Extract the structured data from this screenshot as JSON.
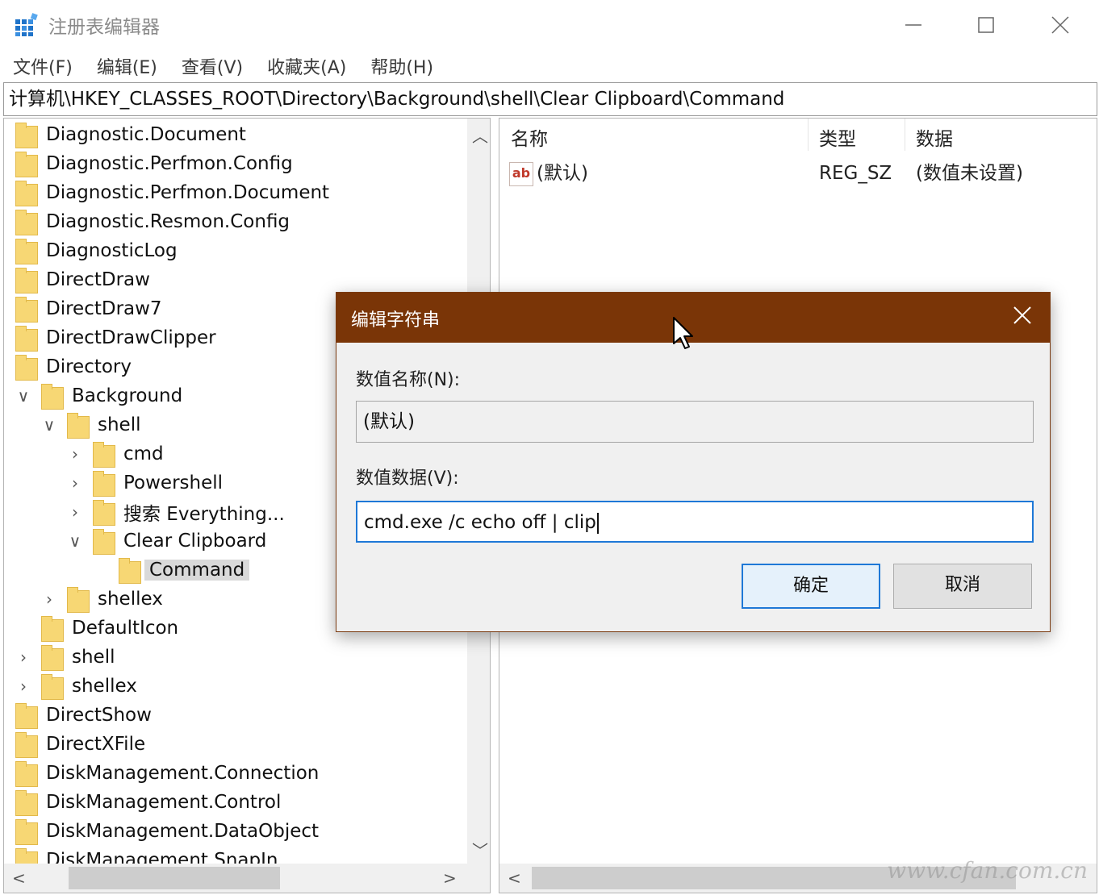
{
  "window": {
    "title": "注册表编辑器",
    "minimize_icon": "minimize-icon",
    "maximize_icon": "maximize-icon",
    "close_icon": "close-icon"
  },
  "menu": [
    "文件(F)",
    "编辑(E)",
    "查看(V)",
    "收藏夹(A)",
    "帮助(H)"
  ],
  "address": "计算机\\HKEY_CLASSES_ROOT\\Directory\\Background\\shell\\Clear Clipboard\\Command",
  "tree": [
    {
      "label": "Diagnostic.Document",
      "level": 0,
      "expander": ""
    },
    {
      "label": "Diagnostic.Perfmon.Config",
      "level": 0,
      "expander": ""
    },
    {
      "label": "Diagnostic.Perfmon.Document",
      "level": 0,
      "expander": ""
    },
    {
      "label": "Diagnostic.Resmon.Config",
      "level": 0,
      "expander": ""
    },
    {
      "label": "DiagnosticLog",
      "level": 0,
      "expander": ""
    },
    {
      "label": "DirectDraw",
      "level": 0,
      "expander": ""
    },
    {
      "label": "DirectDraw7",
      "level": 0,
      "expander": ""
    },
    {
      "label": "DirectDrawClipper",
      "level": 0,
      "expander": ""
    },
    {
      "label": "Directory",
      "level": 0,
      "expander": ""
    },
    {
      "label": "Background",
      "level": 1,
      "expander": "expanded"
    },
    {
      "label": "shell",
      "level": 2,
      "expander": "expanded"
    },
    {
      "label": "cmd",
      "level": 3,
      "expander": "collapsed"
    },
    {
      "label": "Powershell",
      "level": 3,
      "expander": "collapsed"
    },
    {
      "label": "搜索 Everything...",
      "level": 3,
      "expander": "collapsed"
    },
    {
      "label": "Clear Clipboard",
      "level": 3,
      "expander": "expanded"
    },
    {
      "label": "Command",
      "level": 4,
      "expander": "",
      "selected": true
    },
    {
      "label": "shellex",
      "level": 2,
      "expander": "collapsed"
    },
    {
      "label": "DefaultIcon",
      "level": 1,
      "expander": ""
    },
    {
      "label": "shell",
      "level": 1,
      "expander": "collapsed"
    },
    {
      "label": "shellex",
      "level": 1,
      "expander": "collapsed"
    },
    {
      "label": "DirectShow",
      "level": 0,
      "expander": ""
    },
    {
      "label": "DirectXFile",
      "level": 0,
      "expander": ""
    },
    {
      "label": "DiskManagement.Connection",
      "level": 0,
      "expander": ""
    },
    {
      "label": "DiskManagement.Control",
      "level": 0,
      "expander": ""
    },
    {
      "label": "DiskManagement.DataObject",
      "level": 0,
      "expander": ""
    },
    {
      "label": "DiskManagement.SnapIn",
      "level": 0,
      "expander": ""
    }
  ],
  "list": {
    "columns": [
      "名称",
      "类型",
      "数据"
    ],
    "rows": [
      {
        "icon": "string-value-icon",
        "icon_text": "ab",
        "name": "(默认)",
        "type": "REG_SZ",
        "data": "(数值未设置)"
      }
    ]
  },
  "dialog": {
    "title": "编辑字符串",
    "name_label": "数值名称(N):",
    "name_value": "(默认)",
    "data_label": "数值数据(V):",
    "data_value": "cmd.exe /c echo off | clip",
    "ok_label": "确定",
    "cancel_label": "取消"
  },
  "watermark": "www.cfan.com.cn",
  "colors": {
    "dialog_title_bg": "#7a3507",
    "focus_border": "#1e78d7",
    "folder": "#f7d774"
  }
}
